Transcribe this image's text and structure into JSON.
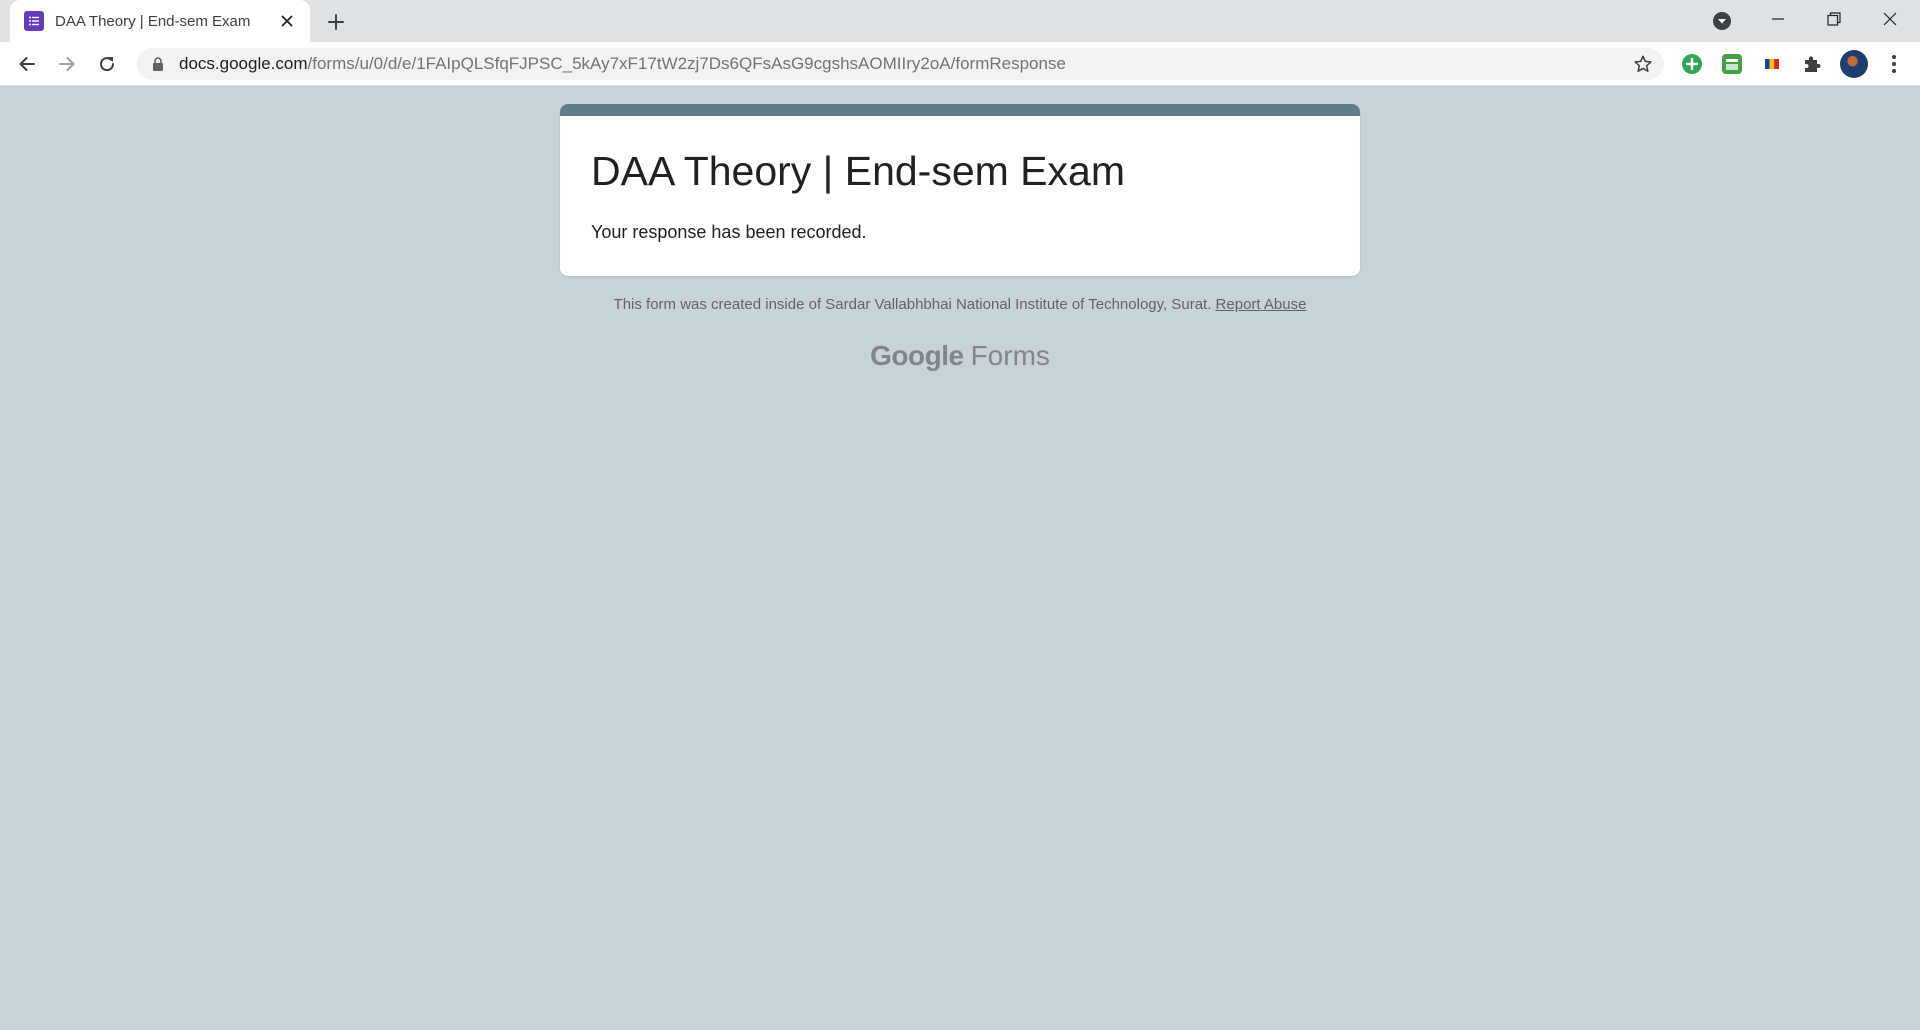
{
  "browser": {
    "tab": {
      "title": "DAA Theory | End-sem Exam",
      "favicon": "forms-icon",
      "favicon_color": "#673ab7"
    },
    "address_bar": {
      "host": "docs.google.com",
      "path": "/forms/u/0/d/e/1FAIpQLSfqFJPSC_5kAy7xF17tW2zj7Ds6QFsAsG9cgshsAOMIIry2oA/formResponse"
    },
    "extensions": [
      "green-plus-extension-icon",
      "green-tool-extension-icon",
      "flag-extension-icon",
      "puzzle-icon"
    ]
  },
  "form": {
    "title": "DAA Theory | End-sem Exam",
    "confirmation_message": "Your response has been recorded.",
    "accent_color": "#607d8b",
    "background_color": "#c8d3d9"
  },
  "footer": {
    "note": "This form was created inside of Sardar Vallabhbhai National Institute of Technology, Surat.",
    "report_link": "Report Abuse",
    "brand_google": "Google",
    "brand_forms": "Forms"
  }
}
